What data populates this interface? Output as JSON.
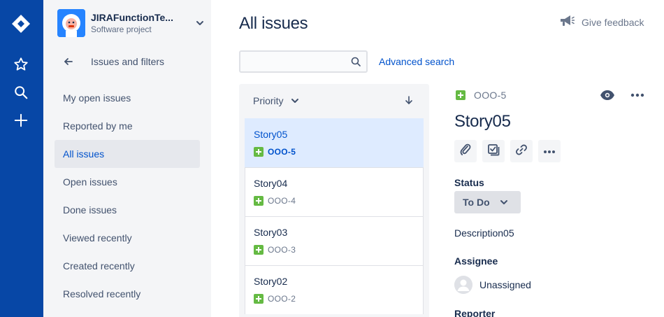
{
  "global_nav": {
    "icons": [
      "jira-logo-icon",
      "star-icon",
      "search-icon",
      "plus-icon"
    ]
  },
  "sidebar": {
    "project_name": "JIRAFunctionTe...",
    "project_type": "Software project",
    "back_label": "Issues and filters",
    "items": [
      {
        "label": "My open issues"
      },
      {
        "label": "Reported by me"
      },
      {
        "label": "All issues",
        "active": true
      },
      {
        "label": "Open issues"
      },
      {
        "label": "Done issues"
      },
      {
        "label": "Viewed recently"
      },
      {
        "label": "Created recently"
      },
      {
        "label": "Resolved recently"
      }
    ]
  },
  "header": {
    "title": "All issues",
    "feedback_label": "Give feedback"
  },
  "search": {
    "value": "",
    "placeholder": "",
    "advanced_label": "Advanced search"
  },
  "list": {
    "sort_label": "Priority",
    "cards": [
      {
        "summary": "Story05",
        "key": "OOO-5",
        "selected": true
      },
      {
        "summary": "Story04",
        "key": "OOO-4"
      },
      {
        "summary": "Story03",
        "key": "OOO-3"
      },
      {
        "summary": "Story02",
        "key": "OOO-2"
      }
    ]
  },
  "detail": {
    "key": "OOO-5",
    "title": "Story05",
    "status_label": "Status",
    "status_value": "To Do",
    "description": "Description05",
    "assignee_label": "Assignee",
    "assignee_value": "Unassigned",
    "reporter_label": "Reporter"
  },
  "colors": {
    "nav_blue": "#0747a6",
    "link_blue": "#0052cc",
    "story_green": "#65ba43",
    "selected_bg": "#deebff"
  }
}
